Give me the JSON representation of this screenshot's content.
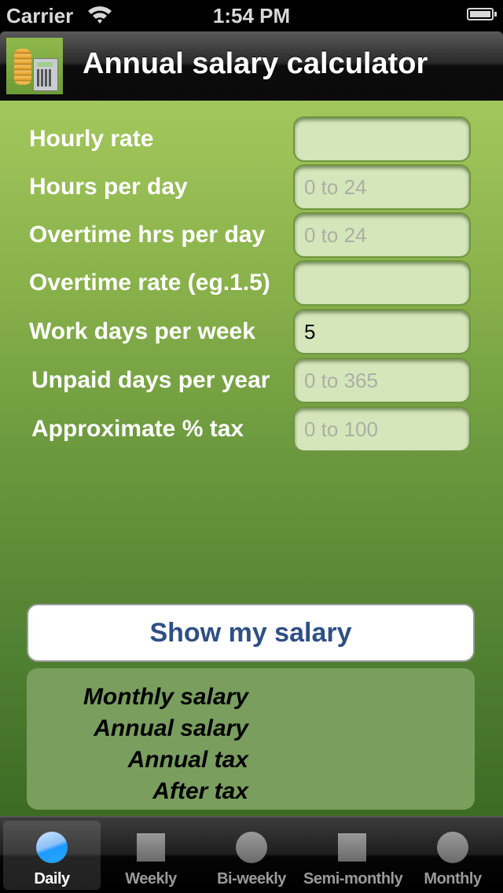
{
  "status_bar": {
    "carrier": "Carrier",
    "time": "1:54 PM",
    "wifi_icon": "wifi-icon",
    "battery_icon": "battery-icon"
  },
  "nav": {
    "title": "Annual salary calculator",
    "app_icon": "coins-calculator-icon"
  },
  "form": {
    "fields": [
      {
        "label": "Hourly rate",
        "value": "",
        "placeholder": ""
      },
      {
        "label": "Hours per day",
        "value": "",
        "placeholder": "0 to 24"
      },
      {
        "label": "Overtime hrs per day",
        "value": "",
        "placeholder": "0 to 24"
      },
      {
        "label": "Overtime rate (eg.1.5)",
        "value": "",
        "placeholder": ""
      },
      {
        "label": "Work days per week",
        "value": "5",
        "placeholder": ""
      },
      {
        "label": "Unpaid days per year",
        "value": "",
        "placeholder": "0 to 365"
      },
      {
        "label": "Approximate % tax",
        "value": "",
        "placeholder": "0 to 100"
      }
    ]
  },
  "show_button_label": "Show my salary",
  "results": [
    {
      "label": "Monthly salary",
      "value": ""
    },
    {
      "label": "Annual salary",
      "value": ""
    },
    {
      "label": "Annual tax",
      "value": ""
    },
    {
      "label": "After tax",
      "value": ""
    }
  ],
  "tabs": [
    {
      "label": "Daily",
      "icon": "circle-icon",
      "selected": true
    },
    {
      "label": "Weekly",
      "icon": "square-icon",
      "selected": false
    },
    {
      "label": "Bi-weekly",
      "icon": "circle-icon",
      "selected": false
    },
    {
      "label": "Semi-monthly",
      "icon": "square-icon",
      "selected": false
    },
    {
      "label": "Monthly",
      "icon": "circle-icon",
      "selected": false
    }
  ],
  "colors": {
    "button_text": "#2f4f86",
    "selected_tab_icon": "#1e9bff",
    "background_top": "#a2c75c",
    "background_bottom": "#3c6b24",
    "results_panel": "#7a9e5e"
  }
}
